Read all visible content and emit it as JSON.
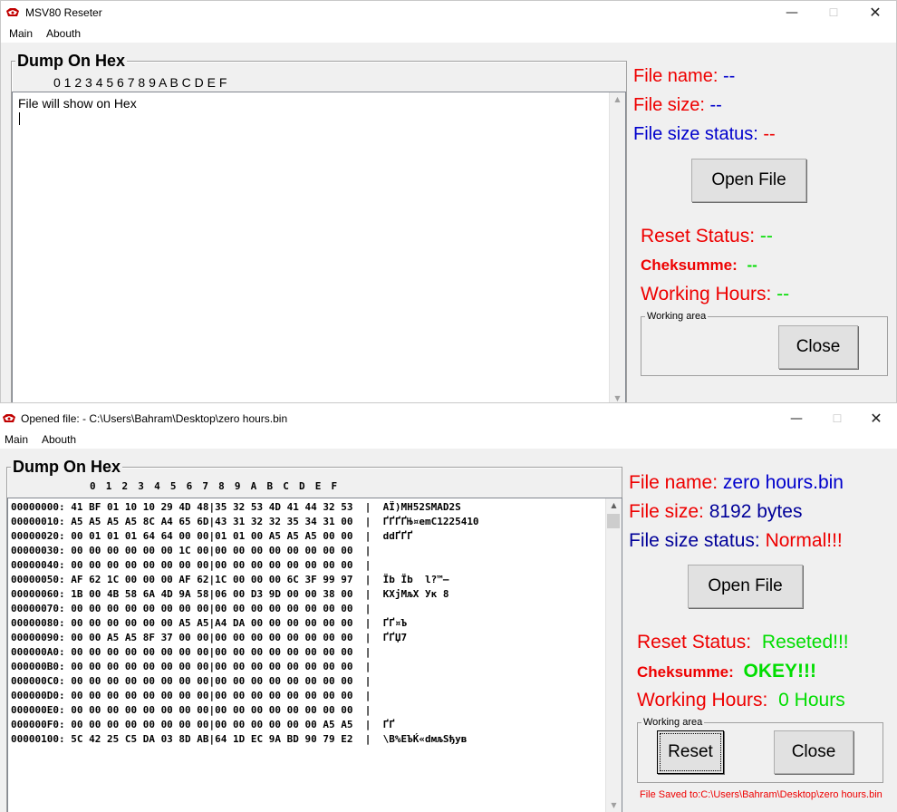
{
  "window1": {
    "title": "MSV80 Reseter",
    "menu": [
      "Main",
      "Abouth"
    ],
    "dump": {
      "title": "Dump On Hex",
      "hex_header": "0 1 2 3 4 5 6 7 8 9 A B C D E F",
      "content": "File will show on Hex"
    },
    "info": {
      "file_name_label": "File name:",
      "file_name_value": "--",
      "file_size_label": "File size:",
      "file_size_value": "--",
      "file_status_label": "File size status:",
      "file_status_value": "--"
    },
    "open_button": "Open File",
    "reset_status_label": "Reset Status:",
    "reset_status_value": "--",
    "checksum_label": "Cheksumme:",
    "checksum_value": "--",
    "hours_label": "Working Hours:",
    "hours_value": "--",
    "working_area": {
      "title": "Working area",
      "close_button": "Close"
    }
  },
  "window2": {
    "title": "Opened file: - C:\\Users\\Bahram\\Desktop\\zero hours.bin",
    "menu": [
      "Main",
      "Abouth"
    ],
    "dump": {
      "title": "Dump On Hex",
      "hex_header": "0  1  2  3  4  5  6  7  8  9  A  B  C  D  E  F",
      "lines": [
        "00000000: 41 BF 01 10 10 29 4D 48|35 32 53 4D 41 44 32 53  |  AЇ)MH52SMAD2S",
        "00000010: A5 A5 A5 A5 8C A4 65 6D|43 31 32 32 35 34 31 00  |  ҐҐҐҐЊ¤emC1225410",
        "00000020: 00 01 01 01 64 64 00 00|01 01 00 A5 A5 A5 00 00  |  ddҐҐҐ",
        "00000030: 00 00 00 00 00 00 1C 00|00 00 00 00 00 00 00 00  |",
        "00000040: 00 00 00 00 00 00 00 00|00 00 00 00 00 00 00 00  |",
        "00000050: AF 62 1C 00 00 00 AF 62|1C 00 00 00 6C 3F 99 97  |  Їb Їb  l?™—",
        "00000060: 1B 00 4B 58 6A 4D 9A 58|06 00 D3 9D 00 00 38 00  |  KXjMљX Ук 8",
        "00000070: 00 00 00 00 00 00 00 00|00 00 00 00 00 00 00 00  |",
        "00000080: 00 00 00 00 00 00 A5 A5|A4 DA 00 00 00 00 00 00  |  ҐҐ¤Ъ",
        "00000090: 00 00 A5 A5 8F 37 00 00|00 00 00 00 00 00 00 00  |  ҐҐЏ7",
        "000000A0: 00 00 00 00 00 00 00 00|00 00 00 00 00 00 00 00  |",
        "000000B0: 00 00 00 00 00 00 00 00|00 00 00 00 00 00 00 00  |",
        "000000C0: 00 00 00 00 00 00 00 00|00 00 00 00 00 00 00 00  |",
        "000000D0: 00 00 00 00 00 00 00 00|00 00 00 00 00 00 00 00  |",
        "000000E0: 00 00 00 00 00 00 00 00|00 00 00 00 00 00 00 00  |",
        "000000F0: 00 00 00 00 00 00 00 00|00 00 00 00 00 00 A5 A5  |  ҐҐ",
        "00000100: 5C 42 25 C5 DA 03 8D AB|64 1D EC 9A BD 90 79 E2  |  \\B%ЕЪЌ«dмљЅђyв"
      ]
    },
    "info": {
      "file_name_label": "File name:",
      "file_name_value": "zero hours.bin",
      "file_size_label": "File size:",
      "file_size_value": "8192 bytes",
      "file_status_label": "File size status:",
      "file_status_value": "Normal!!!"
    },
    "open_button": "Open File",
    "reset_status_label": "Reset Status:",
    "reset_status_value": "Reseted!!!",
    "checksum_label": "Cheksumme:",
    "checksum_value": "OKEY!!!",
    "hours_label": "Working Hours:",
    "hours_value": "0 Hours",
    "working_area": {
      "title": "Working area",
      "reset_button": "Reset",
      "close_button": "Close"
    },
    "status_line": "File Saved to:C:\\Users\\Bahram\\Desktop\\zero hours.bin"
  },
  "colors": {
    "label_red": "#ee0000",
    "label_blue": "#0000cc",
    "value_green": "#00dd00",
    "value_blue": "#000099"
  }
}
